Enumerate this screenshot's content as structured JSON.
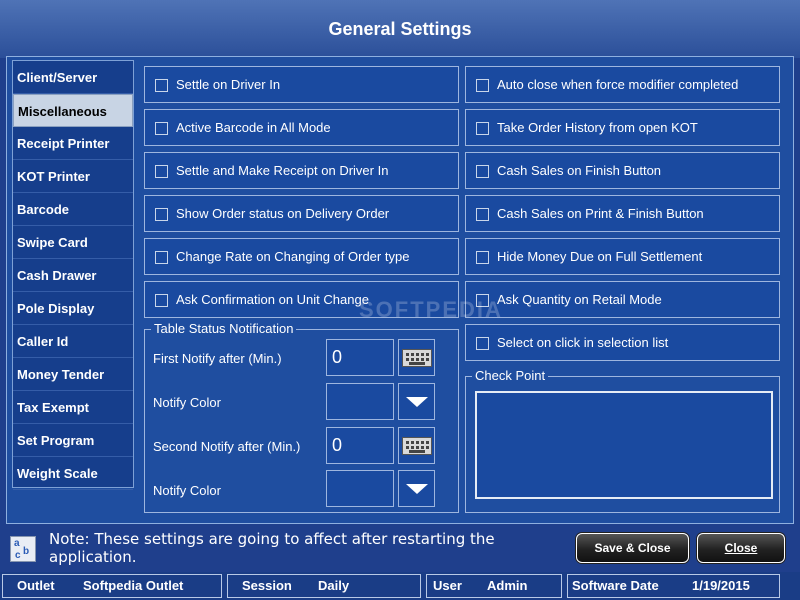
{
  "window": {
    "title": "General Settings"
  },
  "sidebar": {
    "items": [
      {
        "label": "Client/Server"
      },
      {
        "label": "Miscellaneous"
      },
      {
        "label": "Receipt Printer"
      },
      {
        "label": "KOT Printer"
      },
      {
        "label": "Barcode"
      },
      {
        "label": "Swipe Card"
      },
      {
        "label": "Cash Drawer"
      },
      {
        "label": "Pole Display"
      },
      {
        "label": "Caller Id"
      },
      {
        "label": "Money Tender"
      },
      {
        "label": "Tax Exempt"
      },
      {
        "label": "Set Program"
      },
      {
        "label": "Weight Scale"
      }
    ],
    "active": "Miscellaneous"
  },
  "options_left": [
    {
      "label": "Settle on Driver In",
      "checked": false
    },
    {
      "label": "Active Barcode in All Mode",
      "checked": false
    },
    {
      "label": "Settle and Make Receipt on Driver In",
      "checked": false
    },
    {
      "label": "Show Order status on Delivery Order",
      "checked": false
    },
    {
      "label": "Change Rate on Changing of Order type",
      "checked": false
    },
    {
      "label": "Ask Confirmation on Unit Change",
      "checked": false
    }
  ],
  "options_right": [
    {
      "label": "Auto close when force modifier completed",
      "checked": false
    },
    {
      "label": "Take Order History from open KOT",
      "checked": false
    },
    {
      "label": "Cash Sales on Finish Button",
      "checked": false
    },
    {
      "label": "Cash Sales on Print & Finish Button",
      "checked": false
    },
    {
      "label": "Hide Money Due on Full Settlement",
      "checked": false
    },
    {
      "label": "Ask Quantity on Retail Mode",
      "checked": false
    },
    {
      "label": "Select on click in selection list",
      "checked": false
    }
  ],
  "table_status": {
    "title": "Table Status Notification",
    "first_notify_label": "First Notify after (Min.)",
    "first_notify_value": "0",
    "notify_color_label_1": "Notify Color",
    "second_notify_label": "Second Notify after (Min.)",
    "second_notify_value": "0",
    "notify_color_label_2": "Notify Color"
  },
  "check_point": {
    "title": "Check Point"
  },
  "footer": {
    "note": "Note: These settings are going to affect after restarting the application.",
    "save_close_label": "Save & Close",
    "close_label": "Close"
  },
  "statusbar": {
    "outlet_label": "Outlet",
    "outlet_value": "Softpedia Outlet",
    "session_label": "Session",
    "session_value": "Daily",
    "user_label": "User",
    "user_value": "Admin",
    "date_label": "Software Date",
    "date_value": "1/19/2015"
  },
  "watermark": "SOFTPEDIA",
  "colors": {
    "background": "#1f3f8c",
    "panel": "#1f4ea0",
    "active_tab": "#c8d4e4"
  }
}
